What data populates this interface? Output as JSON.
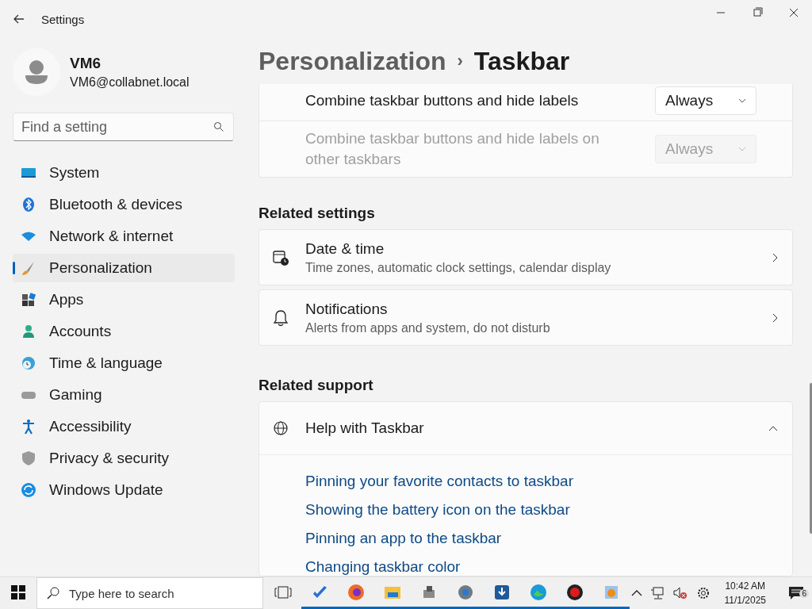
{
  "window": {
    "title": "Settings"
  },
  "user": {
    "name": "VM6",
    "email": "VM6@collabnet.local"
  },
  "search": {
    "placeholder": "Find a setting"
  },
  "nav": [
    {
      "label": "System",
      "selected": false
    },
    {
      "label": "Bluetooth & devices",
      "selected": false
    },
    {
      "label": "Network & internet",
      "selected": false
    },
    {
      "label": "Personalization",
      "selected": true
    },
    {
      "label": "Apps",
      "selected": false
    },
    {
      "label": "Accounts",
      "selected": false
    },
    {
      "label": "Time & language",
      "selected": false
    },
    {
      "label": "Gaming",
      "selected": false
    },
    {
      "label": "Accessibility",
      "selected": false
    },
    {
      "label": "Privacy & security",
      "selected": false
    },
    {
      "label": "Windows Update",
      "selected": false
    }
  ],
  "breadcrumb": {
    "parent": "Personalization",
    "separator": "›",
    "current": "Taskbar"
  },
  "behaviors": [
    {
      "label": "Combine taskbar buttons and hide labels",
      "value": "Always",
      "disabled": false
    },
    {
      "label": "Combine taskbar buttons and hide labels on other taskbars",
      "value": "Always",
      "disabled": true
    }
  ],
  "related_settings": {
    "heading": "Related settings",
    "items": [
      {
        "title": "Date & time",
        "subtitle": "Time zones, automatic clock settings, calendar display"
      },
      {
        "title": "Notifications",
        "subtitle": "Alerts from apps and system, do not disturb"
      }
    ]
  },
  "related_support": {
    "heading": "Related support",
    "title": "Help with Taskbar",
    "expanded": true,
    "links": [
      "Pinning your favorite contacts to taskbar",
      "Showing the battery icon on the taskbar",
      "Pinning an app to the taskbar",
      "Changing taskbar color"
    ]
  },
  "taskbar": {
    "search_placeholder": "Type here to search",
    "apps": [
      {
        "running": true
      },
      {
        "running": true
      },
      {
        "running": true
      },
      {
        "running": true
      },
      {
        "running": true
      },
      {
        "running": true
      },
      {
        "running": true
      },
      {
        "running": true
      },
      {
        "running": true
      }
    ],
    "time": "10:42 AM",
    "date": "11/1/2025",
    "notifications": "6"
  }
}
